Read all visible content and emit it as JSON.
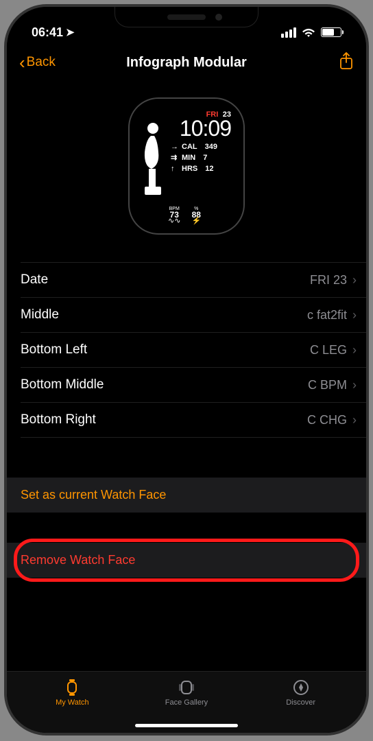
{
  "status": {
    "time": "06:41",
    "location_icon": "location-icon"
  },
  "nav": {
    "back": "Back",
    "title": "Infograph Modular"
  },
  "watchface": {
    "day_label": "FRI",
    "day_num": "23",
    "time": "10:09",
    "cal": {
      "label": "CAL",
      "value": "349"
    },
    "min": {
      "label": "MIN",
      "value": "7"
    },
    "hrs": {
      "label": "HRS",
      "value": "12"
    },
    "bpm": {
      "label": "BPM",
      "value": "73"
    },
    "chg": {
      "label": "%",
      "value": "88"
    }
  },
  "complications": [
    {
      "label": "Date",
      "value": "FRI 23"
    },
    {
      "label": "Middle",
      "value": "c fat2fit"
    },
    {
      "label": "Bottom Left",
      "value": "C LEG"
    },
    {
      "label": "Bottom Middle",
      "value": "C BPM"
    },
    {
      "label": "Bottom Right",
      "value": "C CHG"
    }
  ],
  "actions": {
    "set_current": "Set as current Watch Face",
    "remove": "Remove Watch Face"
  },
  "tabs": {
    "my_watch": "My Watch",
    "face_gallery": "Face Gallery",
    "discover": "Discover"
  }
}
